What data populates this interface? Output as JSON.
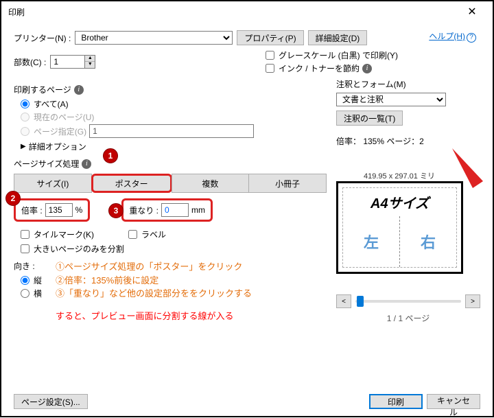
{
  "window": {
    "title": "印刷",
    "close": "✕"
  },
  "help": {
    "label": "ヘルプ(H)"
  },
  "printer": {
    "label": "プリンター(N) :",
    "value": "Brother",
    "properties": "プロパティ(P)",
    "advanced": "詳細設定(D)"
  },
  "copies": {
    "label": "部数(C) :",
    "value": "1"
  },
  "options": {
    "grayscale": "グレースケール (白黒) で印刷(Y)",
    "ink": "インク / トナーを節約"
  },
  "pages": {
    "title": "印刷するページ",
    "all": "すべて(A)",
    "current": "現在のページ(U)",
    "specify": "ページ指定(G)",
    "specify_value": "1",
    "more": "詳細オプション"
  },
  "sizing": {
    "title": "ページサイズ処理",
    "tabs": {
      "size": "サイズ(I)",
      "poster": "ポスター",
      "multiple": "複数",
      "booklet": "小冊子"
    }
  },
  "scale": {
    "label": "倍率 :",
    "value": "135",
    "unit": "%",
    "overlap_label": "重なり :",
    "overlap_value": "0",
    "overlap_unit": "mm"
  },
  "checks": {
    "tile": "タイルマーク(K)",
    "label": "ラベル",
    "large": "大きいページのみを分割"
  },
  "orient": {
    "title": "向き :",
    "portrait": "縦",
    "landscape": "横"
  },
  "annot": {
    "l1": "①ページサイズ処理の「ポスター」をクリック",
    "l2": "②倍率：135%前後に設定",
    "l3": "③「重なり」など他の設定部分ををクリックする",
    "l4": "すると、プレビュー画面に分割する線が入る"
  },
  "comments": {
    "title": "注釈とフォーム(M)",
    "value": "文書と注釈",
    "list": "注釈の一覧(T)"
  },
  "preview": {
    "info": "倍率： 135% ページ：2",
    "dim": "419.95 x 297.01 ミリ",
    "a4": "A4サイズ",
    "left": "左",
    "right": "右",
    "nav_prev": "<",
    "nav_next": ">",
    "page": "1 / 1 ページ"
  },
  "footer": {
    "pagesetup": "ページ設定(S)...",
    "print": "印刷",
    "cancel": "キャンセル"
  },
  "badges": {
    "b1": "1",
    "b2": "2",
    "b3": "3"
  }
}
